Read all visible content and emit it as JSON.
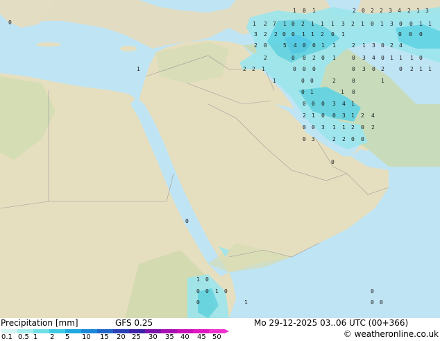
{
  "legend": {
    "title": "Precipitation [mm]",
    "model": "GFS 0.25",
    "datetime": "Mo 29-12-2025 03..06 UTC (00+366)",
    "credit": "© weatheronline.co.uk",
    "ticks": [
      "0.1",
      "0.5",
      "1",
      "2",
      "5",
      "10",
      "15",
      "20",
      "25",
      "30",
      "35",
      "40",
      "45",
      "50"
    ],
    "colors": [
      "#d6f5f5",
      "#a5eded",
      "#6fdfe6",
      "#3fc9e4",
      "#1fa7e0",
      "#1a87d8",
      "#1f64c8",
      "#2b3fb5",
      "#3b22a6",
      "#7a12a8",
      "#a50fb0",
      "#c90fb8",
      "#e016c0",
      "#f030cc"
    ]
  },
  "map_values": [
    "0",
    "1",
    "0",
    "1",
    "2",
    "0",
    "2",
    "2",
    "3",
    "4",
    "2",
    "1",
    "3",
    "1",
    "2",
    "7",
    "1",
    "0",
    "2",
    "1",
    "1",
    "1",
    "3",
    "2",
    "1",
    "0",
    "1",
    "3",
    "0",
    "0",
    "1",
    "1",
    "3",
    "2",
    "2",
    "0",
    "0",
    "1",
    "1",
    "2",
    "0",
    "1",
    "0",
    "0",
    "0",
    "2",
    "0",
    "5",
    "4",
    "0",
    "0",
    "1",
    "1",
    "2",
    "1",
    "3",
    "0",
    "2",
    "4",
    "2",
    "0",
    "0",
    "2",
    "0",
    "1",
    "0",
    "3",
    "4",
    "0",
    "1",
    "1",
    "1",
    "0",
    "2",
    "2",
    "1",
    "0",
    "0",
    "0",
    "0",
    "3",
    "0",
    "2",
    "0",
    "2",
    "1",
    "1",
    "1",
    "1",
    "0",
    "0",
    "2",
    "0",
    "1",
    "0",
    "1",
    "1",
    "0",
    "0",
    "0",
    "0",
    "3",
    "4",
    "1",
    "2",
    "1",
    "0",
    "0",
    "3",
    "1",
    "2",
    "4",
    "0",
    "0",
    "3",
    "1",
    "1",
    "2",
    "0",
    "2",
    "0",
    "3",
    "2",
    "2",
    "0",
    "0",
    "0",
    "0",
    "1",
    "0",
    "0",
    "0",
    "1",
    "0",
    "0",
    "1",
    "0",
    "0",
    "0",
    "0"
  ]
}
